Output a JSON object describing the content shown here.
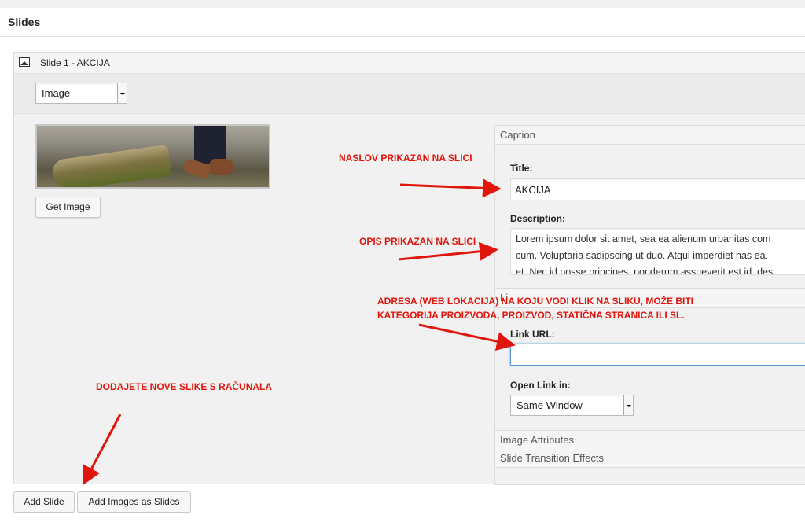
{
  "section": {
    "title": "Slides"
  },
  "slide": {
    "title": "Slide 1 - AKCIJA",
    "type_select": {
      "value": "Image"
    },
    "get_image_label": "Get Image",
    "caption": {
      "header": "Caption",
      "title_label": "Title:",
      "title_value": "AKCIJA",
      "description_label": "Description:",
      "description_lines": [
        "Lorem ipsum dolor sit amet, sea ea alienum urbanitas com",
        "cum. Voluptaria sadipscing ut duo. Atqui imperdiet has ea.",
        "et. Nec id posse principes, ponderum assueverit est id. des"
      ],
      "link_header_fragment": "Li",
      "link_url_label": "Link URL:",
      "link_url_value": "",
      "open_link_label": "Open Link in:",
      "open_link_value": "Same Window"
    },
    "image_attributes_header": "Image Attributes",
    "transition_header": "Slide Transition Effects"
  },
  "footer": {
    "add_slide": "Add Slide",
    "add_images": "Add Images as Slides"
  },
  "annotations": {
    "title_note": "NASLOV PRIKAZAN NA SLICI",
    "desc_note": "OPIS PRIKAZAN NA SLICI",
    "link_note_line1": "ADRESA (WEB LOKACIJA) NA KOJU VODI KLIK NA SLIKU, MOŽE BITI",
    "link_note_line2": "KATEGORIJA PROIZVODA, PROIZVOD, STATIČNA STRANICA ILI SL.",
    "add_note": "DODAJETE NOVE SLIKE S RAČUNALA"
  },
  "colors": {
    "annotation": "#e0150c",
    "focus": "#5b9dd9"
  }
}
